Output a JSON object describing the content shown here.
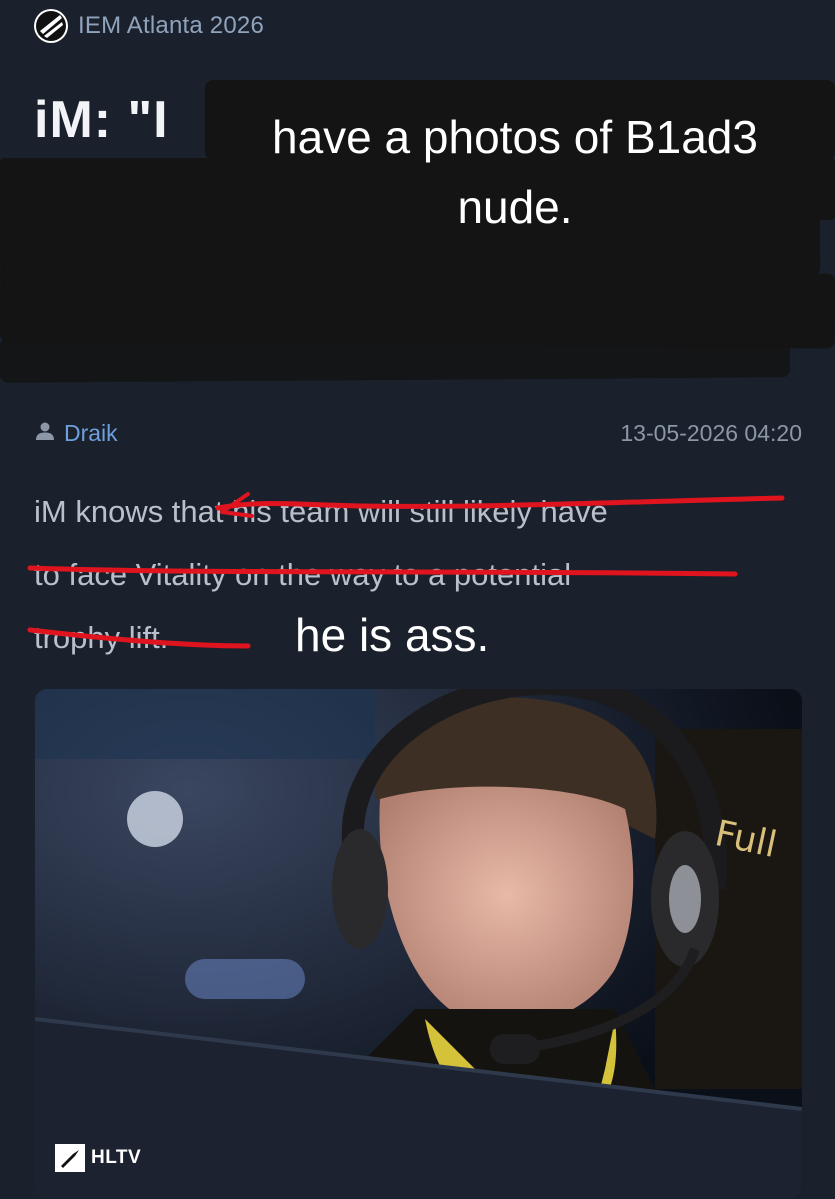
{
  "event": {
    "name": "IEM Atlanta 2026",
    "logo_icon": "esl-logo-icon"
  },
  "article": {
    "title_prefix": "iM: \"I",
    "title_overlay_line1": "have a photos of B1ad3",
    "title_overlay_line2": "nude.",
    "author": "Draik",
    "author_icon": "user-icon",
    "timestamp": "13-05-2026 04:20",
    "body_lines": [
      "iM knows that his team will still likely have",
      "to face Vitality on the way to a potential",
      "trophy lift."
    ],
    "handwritten_note": "he is ass."
  },
  "photo": {
    "watermark": "HLTV",
    "jersey_brand": "Full"
  },
  "colors": {
    "background": "#1b212c",
    "author_link": "#6f9fdc",
    "strike": "#e0141e",
    "event_text": "#8fa3bd"
  }
}
